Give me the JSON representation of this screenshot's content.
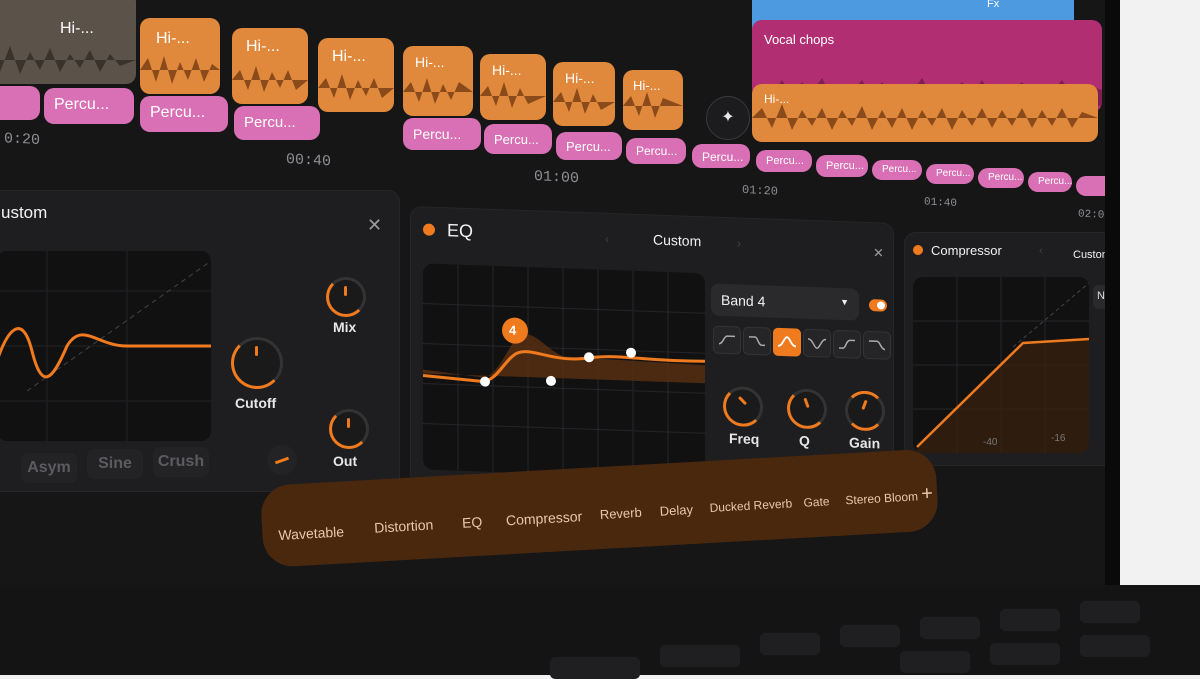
{
  "tracks": {
    "row1": [
      {
        "kind": "gy",
        "label": "Hi-..."
      },
      {
        "kind": "or",
        "label": "Hi-..."
      },
      {
        "kind": "or",
        "label": "Hi-..."
      },
      {
        "kind": "or",
        "label": "Hi-..."
      },
      {
        "kind": "or",
        "label": "Hi-..."
      },
      {
        "kind": "or",
        "label": "Hi-..."
      },
      {
        "kind": "or",
        "label": "Hi-..."
      },
      {
        "kind": "or",
        "label": "Hi-..."
      },
      {
        "kind": "or",
        "label": "Hi-..."
      }
    ],
    "top_blue_label": "Fx",
    "vocal_label": "Vocal chops",
    "perc_label": "Percu..."
  },
  "timeline": {
    "labels": [
      "0:20",
      "00:40",
      "01:00",
      "01:20",
      "01:40",
      "02:0"
    ]
  },
  "panels": {
    "distortion": {
      "title": "ustom",
      "knobs": {
        "mix": "Mix",
        "cutoff": "Cutoff",
        "out": "Out"
      },
      "modes": [
        "Asym",
        "Sine",
        "Crush"
      ]
    },
    "eq": {
      "title": "EQ",
      "preset": "Custom",
      "band_select": "Band 4",
      "band_number": "4",
      "knobs": {
        "freq": "Freq",
        "q": "Q",
        "gain": "Gain"
      }
    },
    "compressor": {
      "title": "Compressor",
      "preset": "Custom",
      "axis": [
        "-40",
        "-16"
      ],
      "side_label": "N"
    }
  },
  "chain": {
    "items": [
      "Wavetable",
      "Distortion",
      "EQ",
      "Compressor",
      "Reverb",
      "Delay",
      "Ducked Reverb",
      "Gate",
      "Stereo Bloom"
    ],
    "add_label": "+"
  },
  "colors": {
    "accent": "#f07a1e",
    "clip_orange": "#e0883b",
    "clip_pink": "#d970b5",
    "clip_blue": "#4e9ae0",
    "clip_magenta": "#b12e73"
  }
}
